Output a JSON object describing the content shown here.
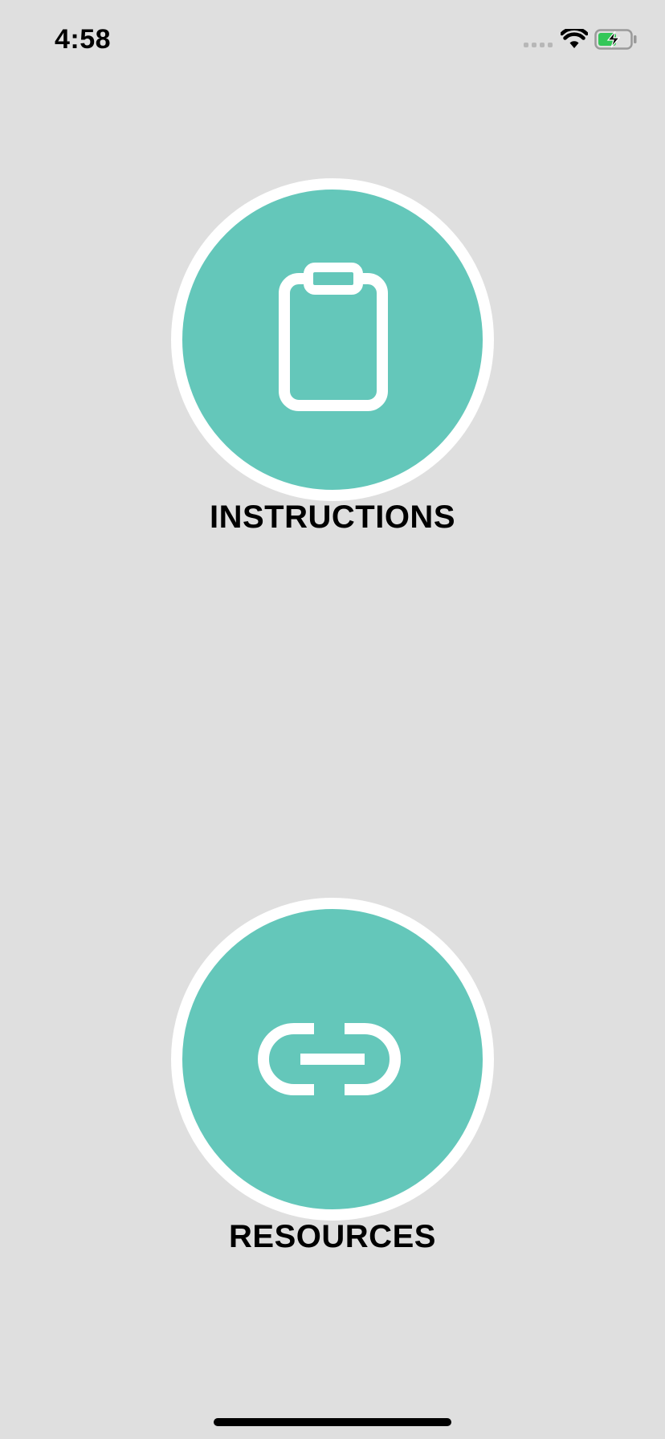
{
  "status_bar": {
    "time": "4:58",
    "signal_icon": "cellular-signal-icon",
    "wifi_icon": "wifi-icon",
    "battery_icon": "battery-charging-icon",
    "battery_color": "#34c759"
  },
  "main": {
    "instructions": {
      "label": "INSTRUCTIONS",
      "icon": "clipboard-icon"
    },
    "resources": {
      "label": "RESOURCES",
      "icon": "link-icon"
    }
  },
  "colors": {
    "background": "#dfdfdf",
    "circle_fill": "#64c7ba",
    "circle_border": "#ffffff",
    "label_text": "#000000"
  }
}
